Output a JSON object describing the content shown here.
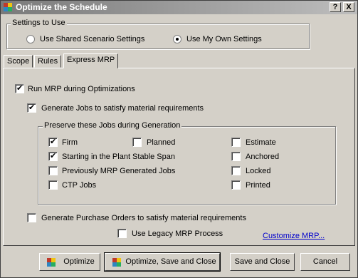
{
  "window": {
    "title": "Optimize the Schedule"
  },
  "titlebar": {
    "help": "?",
    "close": "X"
  },
  "settings_group": {
    "label": "Settings to Use",
    "shared": "Use Shared Scenario Settings",
    "own": "Use My Own Settings",
    "selected": "own"
  },
  "tabs": [
    "Scope",
    "Rules",
    "Express MRP"
  ],
  "active_tab": "Express MRP",
  "mrp": {
    "run_label": "Run MRP during Optimizations",
    "run_checked": true,
    "generate_jobs_label": "Generate Jobs to satisfy material requirements",
    "generate_jobs_checked": true,
    "preserve_group_label": "Preserve these Jobs during Generation",
    "preserve": {
      "firm": "Firm",
      "planned": "Planned",
      "estimate": "Estimate",
      "stable": "Starting in the Plant Stable Span",
      "anchored": "Anchored",
      "prev_mrp": "Previously MRP Generated Jobs",
      "locked": "Locked",
      "ctp": "CTP Jobs",
      "printed": "Printed"
    },
    "generate_po_label": "Generate Purchase Orders to satisfy material requirements",
    "legacy_label": "Use Legacy MRP Process",
    "customize_link": "Customize MRP..."
  },
  "buttons": {
    "optimize": "Optimize",
    "optimize_save_close": "Optimize, Save and Close",
    "save_close": "Save and Close",
    "cancel": "Cancel"
  }
}
